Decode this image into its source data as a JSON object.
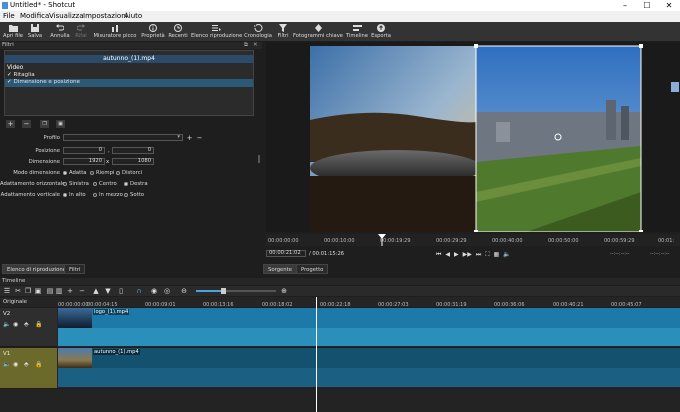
{
  "window": {
    "title": "Untitled* - Shotcut"
  },
  "menu": [
    "File",
    "Modifica",
    "Visualizza",
    "Impostazioni",
    "Aiuto"
  ],
  "toolbar": [
    {
      "label": "Apri file",
      "icon": "folder-open-icon"
    },
    {
      "label": "Salva",
      "icon": "save-icon"
    },
    {
      "label": "Annulla",
      "icon": "undo-icon"
    },
    {
      "label": "Rifai",
      "icon": "redo-icon"
    },
    {
      "label": "Misuratore picco",
      "icon": "peak-meter-icon"
    },
    {
      "label": "Proprietà",
      "icon": "properties-icon"
    },
    {
      "label": "Recenti",
      "icon": "recent-icon"
    },
    {
      "label": "Elenco riproduzione",
      "icon": "playlist-icon"
    },
    {
      "label": "Cronologia",
      "icon": "history-icon"
    },
    {
      "label": "Filtri",
      "icon": "filter-icon"
    },
    {
      "label": "Fotogrammi chiave",
      "icon": "keyframes-icon"
    },
    {
      "label": "Timeline",
      "icon": "timeline-icon"
    },
    {
      "label": "Esporta",
      "icon": "export-icon"
    }
  ],
  "filters": {
    "panel_title": "Filtri",
    "clip_name": "autunno_(1).mp4",
    "section": "Video",
    "items": [
      "Ritaglia",
      "Dimensione e posizione"
    ],
    "profile_label": "Profilo",
    "position_label": "Posizione",
    "position_x": "0",
    "position_y": "0",
    "comma": ",",
    "size_label": "Dimensione",
    "size_w": "1920",
    "size_x": "x",
    "size_h": "1080",
    "mode_label": "Modo dimensione",
    "mode_options": [
      "Adatta",
      "Riempi",
      "Distorci"
    ],
    "halign_label": "Adattamento orizzontale",
    "halign_options": [
      "Sinistra",
      "Centro",
      "Destra"
    ],
    "valign_label": "Adattamento verticale",
    "valign_options": [
      "In alto",
      "In mezzo",
      "Sotto"
    ]
  },
  "left_tabs": [
    "Elenco di riproduzione",
    "Filtri"
  ],
  "player": {
    "ruler": [
      "00:00:00:00",
      "00:00:10:00",
      "00:00:19:29",
      "00:00:29:29",
      "00:00:40:00",
      "00:00:50:00",
      "00:00:59:29",
      "00:01:"
    ],
    "current_time": "00:00:21:02",
    "total_time": "/ 00:01:15:26",
    "in_point": "--:--:--:--",
    "out_point": "--:--:--:--",
    "tabs": [
      "Sorgente",
      "Progetto"
    ]
  },
  "timeline": {
    "title": "Timeline",
    "master": "Originale",
    "ruler": [
      "00:00:00:00",
      "00:00:04:15",
      "00:00:09:01",
      "00:00:13:16",
      "00:00:18:02",
      "00:00:22:18",
      "00:00:27:03",
      "00:00:31:19",
      "00:00:36:06",
      "00:00:40:21",
      "00:00:45:07"
    ],
    "tracks": [
      {
        "name": "V2",
        "clip": "logo_(1).mp4"
      },
      {
        "name": "V1",
        "clip": "autunno_(1).mp4"
      }
    ]
  }
}
